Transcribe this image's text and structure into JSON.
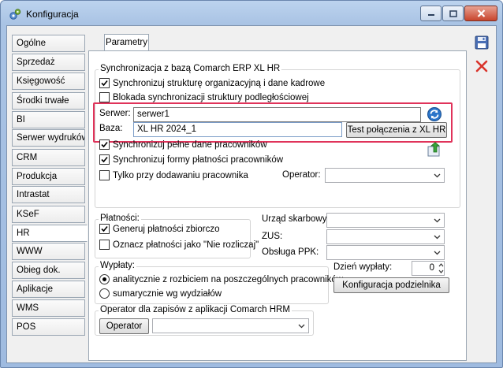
{
  "window": {
    "title": "Konfiguracja"
  },
  "sidebar": {
    "items": [
      {
        "label": "Ogólne"
      },
      {
        "label": "Sprzedaż"
      },
      {
        "label": "Księgowość"
      },
      {
        "label": "Środki trwałe"
      },
      {
        "label": "BI"
      },
      {
        "label": "Serwer wydruków"
      },
      {
        "label": "CRM"
      },
      {
        "label": "Produkcja"
      },
      {
        "label": "Intrastat"
      },
      {
        "label": "KSeF"
      },
      {
        "label": "HR"
      },
      {
        "label": "WWW"
      },
      {
        "label": "Obieg dok."
      },
      {
        "label": "Aplikacje"
      },
      {
        "label": "WMS"
      },
      {
        "label": "POS"
      }
    ],
    "active": "HR"
  },
  "tab": {
    "label": "Parametry"
  },
  "sync": {
    "legend": "Synchronizacja z bazą Comarch ERP XL HR",
    "org_structure": {
      "label": "Synchronizuj strukturę organizacyjną i dane kadrowe",
      "checked": true
    },
    "block_sub": {
      "label": "Blokada synchronizacji struktury podległościowej",
      "checked": false
    },
    "server_label": "Serwer:",
    "server_value": "serwer1",
    "base_label": "Baza:",
    "base_value": "XL HR 2024_1",
    "test_button": "Test połączenia z XL HR",
    "full_data": {
      "label": "Synchronizuj pełne dane pracowników",
      "checked": true
    },
    "payment_forms": {
      "label": "Synchronizuj formy płatności pracowników",
      "checked": true
    },
    "only_adding": {
      "label": "Tylko przy dodawaniu pracownika",
      "checked": false
    },
    "operator_label": "Operator:"
  },
  "payments": {
    "legend": "Płatności:",
    "generate": {
      "label": "Generuj płatności zbiorczo",
      "checked": true
    },
    "mark": {
      "label": "Oznacz płatności jako \"Nie rozliczaj\"",
      "checked": false
    },
    "tax_office_label": "Urząd skarbowy:",
    "zus_label": "ZUS:",
    "ppk_label": "Obsługa PPK:"
  },
  "payouts": {
    "legend": "Wypłaty:",
    "analytic": {
      "label": "analitycznie z rozbiciem na poszczególnych pracowników",
      "selected": true
    },
    "synthetic": {
      "label": "sumarycznie wg wydziałów",
      "selected": false
    },
    "day_label": "Dzień wypłaty:",
    "day_value": "0",
    "divider_button": "Konfiguracja podzielnika"
  },
  "hrm": {
    "legend": "Operator dla zapisów z aplikacji Comarch HRM",
    "operator_button": "Operator"
  },
  "icons": {
    "save": "save-icon",
    "cancel": "cancel-icon",
    "refresh": "refresh-icon",
    "export": "export-icon"
  },
  "colors": {
    "highlight": "#e0335a",
    "window": "#a9c3e4"
  }
}
